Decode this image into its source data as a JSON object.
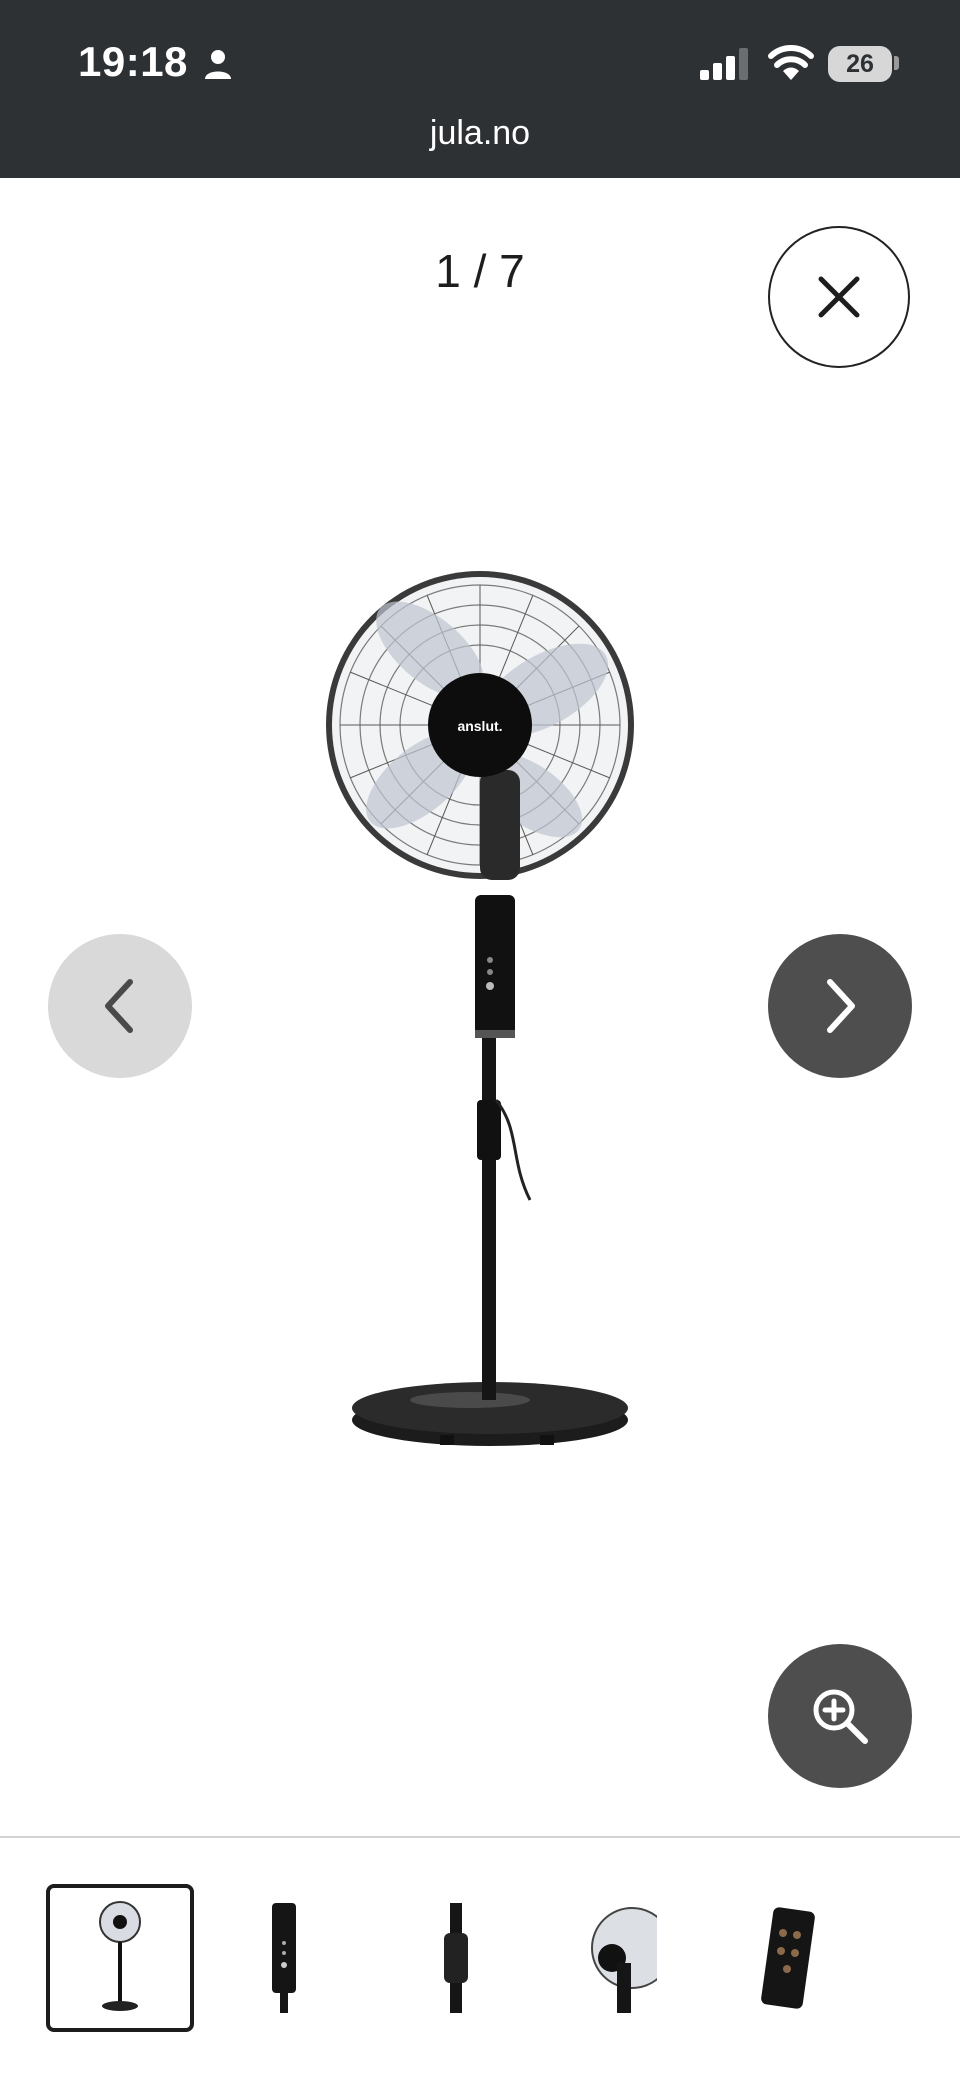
{
  "status_bar": {
    "time": "19:18",
    "battery": "26",
    "icons": [
      "person-icon",
      "cellular-signal-icon",
      "wifi-icon",
      "battery-icon"
    ]
  },
  "browser": {
    "url": "jula.no"
  },
  "gallery": {
    "counter": "1 / 7",
    "product_logo_text": "anslut.",
    "buttons": [
      "close-icon",
      "chevron-left-icon",
      "chevron-right-icon",
      "zoom-in-icon"
    ],
    "thumbnails": [
      {
        "name": "thumbnail-full-fan",
        "active": true
      },
      {
        "name": "thumbnail-control-panel",
        "active": false
      },
      {
        "name": "thumbnail-pole-joint",
        "active": false
      },
      {
        "name": "thumbnail-fan-head-back",
        "active": false
      },
      {
        "name": "thumbnail-remote-control",
        "active": false
      }
    ]
  },
  "colors": {
    "status_bar_bg": "#2e3134",
    "nav_button_dark": "#4e4e4e",
    "nav_button_light": "#d9d9d9"
  }
}
